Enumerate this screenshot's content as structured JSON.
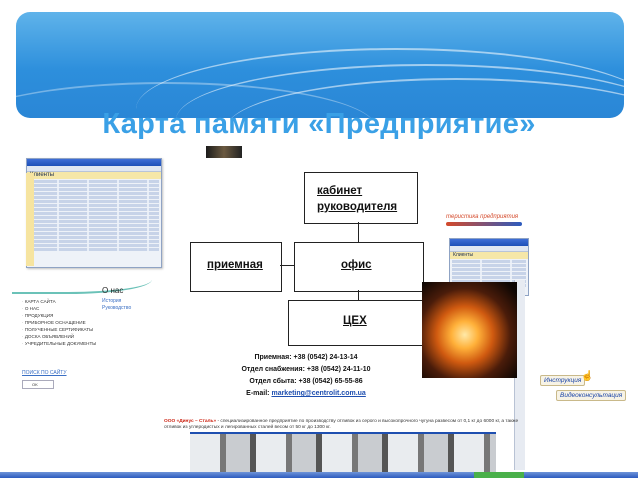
{
  "slide": {
    "title": "Карта памяти «Предприятие»"
  },
  "diagram": {
    "cabinet": "кабинет руководителя",
    "reception": "приемная",
    "office": "офис",
    "workshop": "ЦЕХ"
  },
  "contacts": {
    "reception": "Приемная: +38 (0542) 24-13-14",
    "supply": "Отдел снабжения: +38 (0542) 24-11-10",
    "sales": "Отдел сбыта: +38 (0542) 65-55-86",
    "email_label": "E-mail: ",
    "email": "marketing@centrolit.com.ua"
  },
  "left_window": {
    "title": "Клиенты"
  },
  "left_site": {
    "section_title": "О нас",
    "links": [
      "История",
      "Руководство"
    ],
    "menu": [
      "Карта сайта",
      "О нас",
      "Продукция",
      "Приборное оснащение",
      "Полученные сертификаты",
      "Доска объявлений",
      "Учредительные документы"
    ],
    "search_label": "ПОИСК ПО САЙТУ",
    "search_button": "OK"
  },
  "right_collage": {
    "banner": "теристика предприятия",
    "window_title": "Клиенты",
    "scroll1": "Инструкция",
    "scroll2": "Видеоконсультация"
  },
  "footer": {
    "company_name": "ООО «Динус – Сталь»",
    "company_desc": " - специализированное предприятие по производству отливок из серого и высокопрочного чугуна развесом от 0,1 кг до 6000 кг, а также отливок из углеродистых и легированных сталей весом от 50 кг до 1300 кг."
  },
  "colors": {
    "banner": "#2d8fdc",
    "title": "#3aa0e6",
    "accent_red": "#d4492a"
  }
}
